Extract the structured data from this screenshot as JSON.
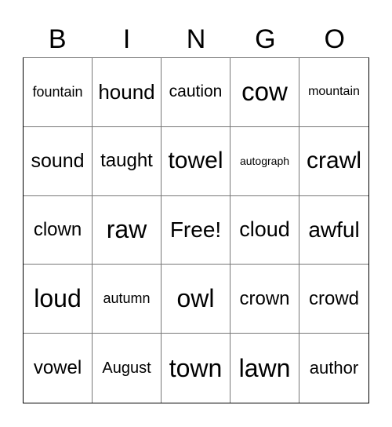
{
  "header": [
    "B",
    "I",
    "N",
    "G",
    "O"
  ],
  "cells": [
    {
      "text": "fountain",
      "size": 18
    },
    {
      "text": "hound",
      "size": 26
    },
    {
      "text": "caution",
      "size": 21
    },
    {
      "text": "cow",
      "size": 33
    },
    {
      "text": "mountain",
      "size": 16
    },
    {
      "text": "sound",
      "size": 25
    },
    {
      "text": "taught",
      "size": 24
    },
    {
      "text": "towel",
      "size": 30
    },
    {
      "text": "autograph",
      "size": 14
    },
    {
      "text": "crawl",
      "size": 30
    },
    {
      "text": "clown",
      "size": 24
    },
    {
      "text": "raw",
      "size": 32
    },
    {
      "text": "Free!",
      "size": 28
    },
    {
      "text": "cloud",
      "size": 27
    },
    {
      "text": "awful",
      "size": 28
    },
    {
      "text": "loud",
      "size": 32
    },
    {
      "text": "autumn",
      "size": 18
    },
    {
      "text": "owl",
      "size": 32
    },
    {
      "text": "crown",
      "size": 24
    },
    {
      "text": "crowd",
      "size": 24
    },
    {
      "text": "vowel",
      "size": 24
    },
    {
      "text": "August",
      "size": 20
    },
    {
      "text": "town",
      "size": 32
    },
    {
      "text": "lawn",
      "size": 32
    },
    {
      "text": "author",
      "size": 22
    }
  ]
}
